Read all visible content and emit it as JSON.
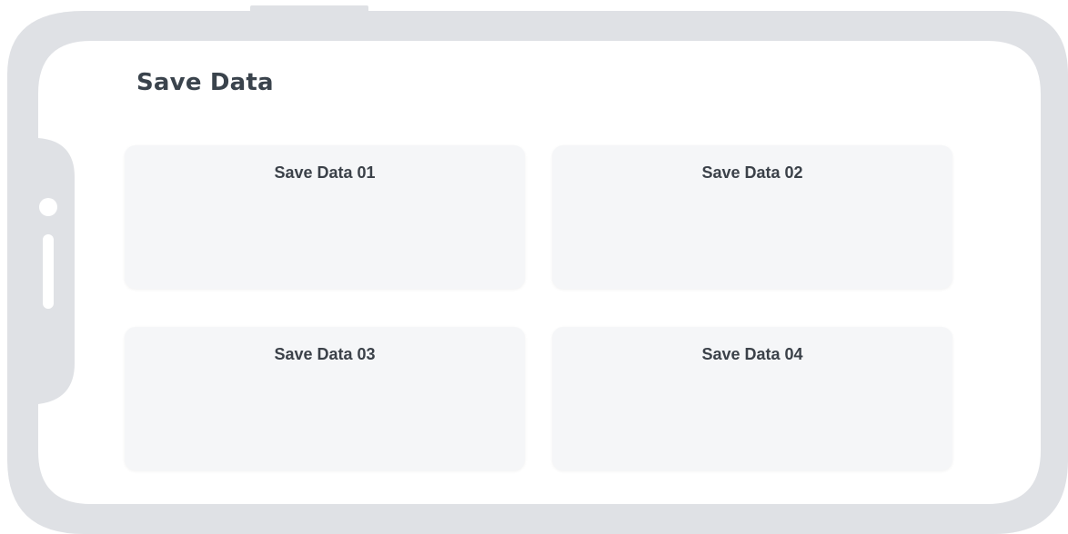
{
  "page": {
    "title": "Save Data"
  },
  "save_slots": [
    {
      "label": "Save Data 01"
    },
    {
      "label": "Save Data 02"
    },
    {
      "label": "Save Data 03"
    },
    {
      "label": "Save Data 04"
    }
  ],
  "colors": {
    "frame": "#dfe1e5",
    "screen": "#ffffff",
    "slot_background": "#f5f6f8",
    "title_text": "#3a434c",
    "slot_text": "#3b4149"
  }
}
